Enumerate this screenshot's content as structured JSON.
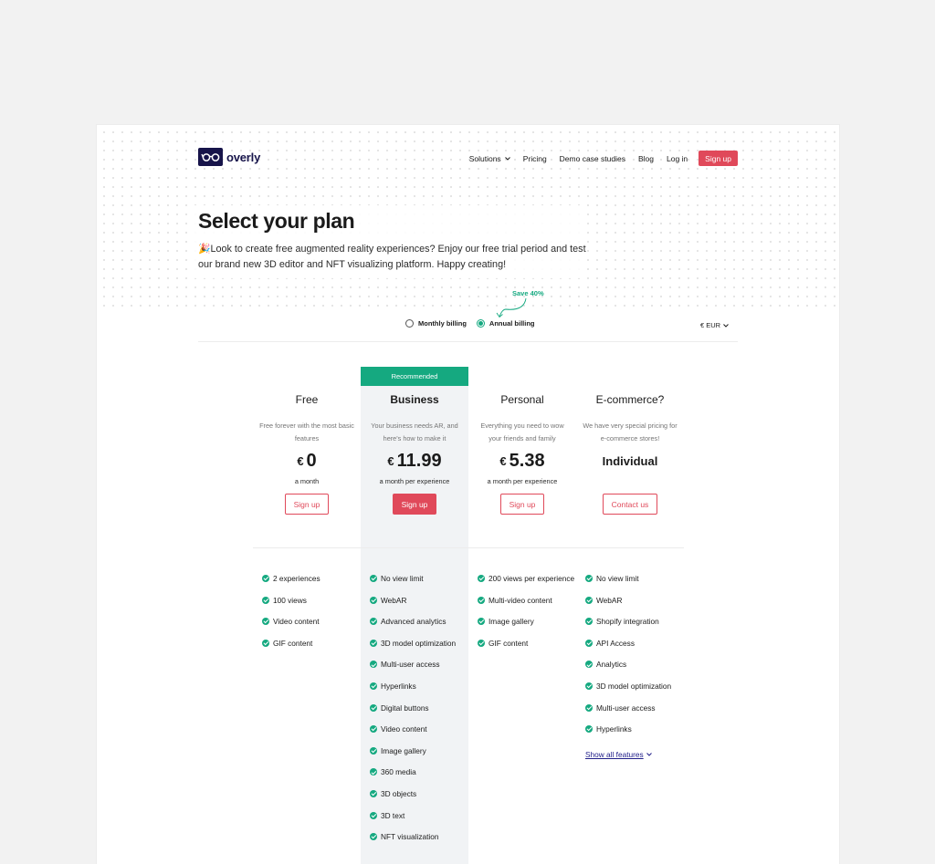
{
  "brand": {
    "name": "overly"
  },
  "nav": {
    "items": [
      {
        "label": "Solutions",
        "dropdown": true
      },
      {
        "label": "Pricing"
      },
      {
        "label": "Demo case studies"
      },
      {
        "label": "Blog"
      },
      {
        "label": "Log in"
      }
    ],
    "signup_label": "Sign up"
  },
  "hero": {
    "title": "Select your plan",
    "subtitle": "🎉Look to create free augmented reality experiences? Enjoy our free trial period and test our brand new 3D editor and NFT visualizing platform. Happy creating!"
  },
  "billing": {
    "save_label": "Save 40%",
    "monthly_label": "Monthly billing",
    "annual_label": "Annual billing",
    "selected": "annual",
    "currency": "€ EUR"
  },
  "recommended_label": "Recommended",
  "plans": [
    {
      "name": "Free",
      "description": "Free forever with the most basic features",
      "currency": "€",
      "price": "0",
      "per": "a month",
      "button": "Sign up",
      "features": [
        "2 experiences",
        "100 views",
        "Video content",
        "GIF content"
      ]
    },
    {
      "name": "Business",
      "description": "Your business needs AR, and here's how to make it",
      "currency": "€",
      "price": "11.99",
      "per": "a month per experience",
      "button": "Sign up",
      "recommended": true,
      "features": [
        "No view limit",
        "WebAR",
        "Advanced analytics",
        "3D model optimization",
        "Multi-user access",
        "Hyperlinks",
        "Digital buttons",
        "Video content",
        "Image gallery",
        "360 media",
        "3D objects",
        "3D text",
        "NFT visualization"
      ]
    },
    {
      "name": "Personal",
      "description": "Everything you need to wow your friends and family",
      "currency": "€",
      "price": "5.38",
      "per": "a month per experience",
      "button": "Sign up",
      "features": [
        "200 views per experience",
        "Multi-video content",
        "Image gallery",
        "GIF content"
      ]
    },
    {
      "name": "E-commerce?",
      "description": "We have very special pricing for e-commerce stores!",
      "price_text": "Individual",
      "button": "Contact us",
      "features": [
        "No view limit",
        "WebAR",
        "Shopify integration",
        "API Access",
        "Analytics",
        "3D model optimization",
        "Multi-user access",
        "Hyperlinks"
      ],
      "show_all_label": "Show all features"
    }
  ],
  "colors": {
    "accent_green": "#15a980",
    "accent_red": "#e0495a",
    "brand_navy": "#17144a",
    "business_bg": "#f1f3f5"
  }
}
